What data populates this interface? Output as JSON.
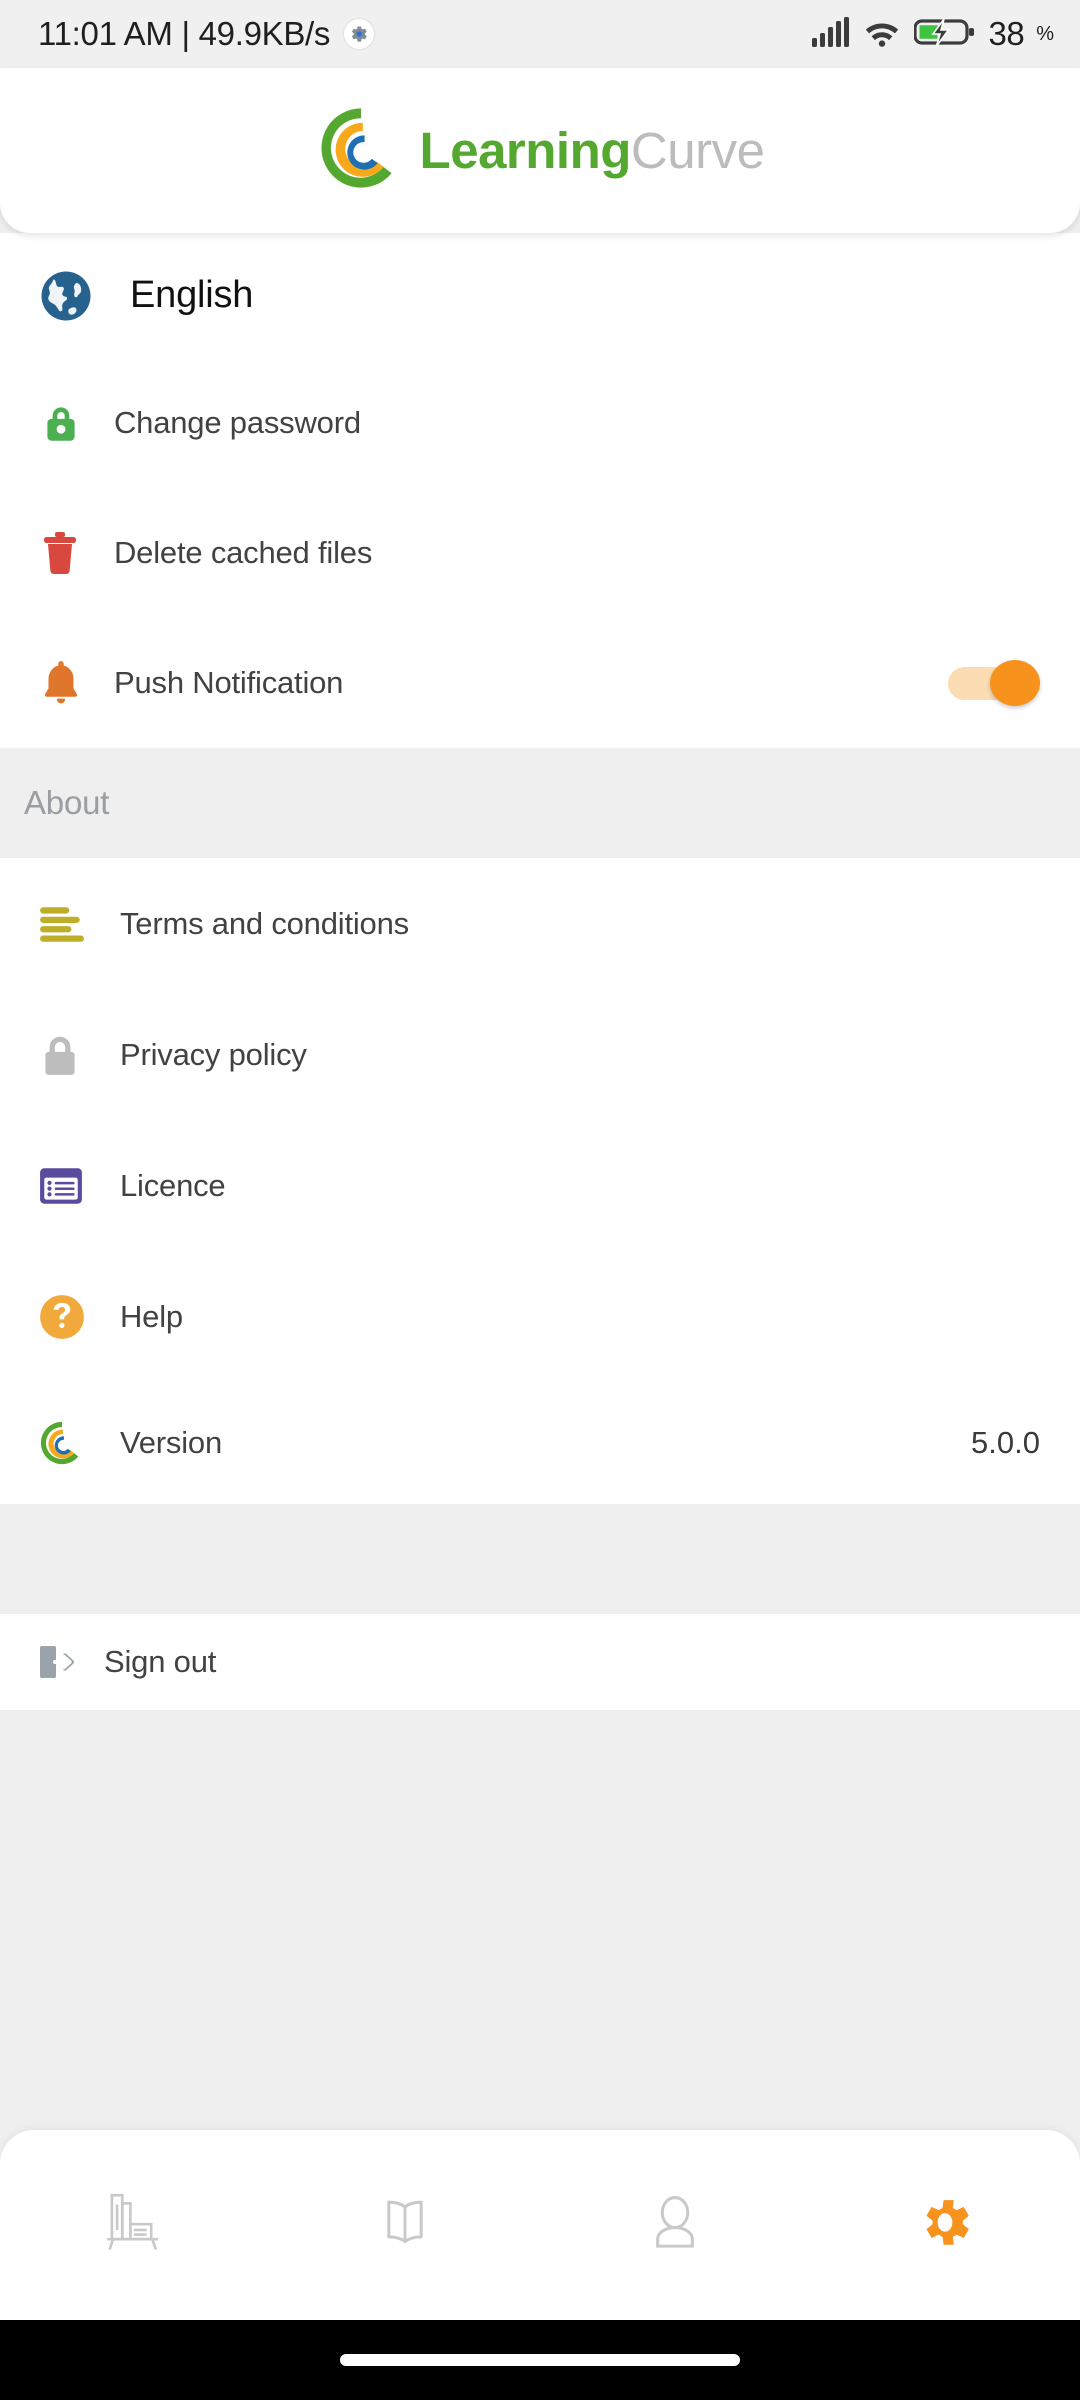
{
  "status_bar": {
    "clock": "11:01 AM | 49.9KB/s",
    "notification_icon": "gear-badge-icon",
    "signal_icon": "cellular-signal-icon",
    "wifi_icon": "wifi-icon",
    "battery_icon": "battery-charging-icon",
    "battery_level": "38",
    "battery_unit": "%"
  },
  "header": {
    "brand_primary": "Learning",
    "brand_secondary": "Curve",
    "logo_icon": "learningcurve-logo-icon",
    "colors": {
      "green": "#54a830",
      "orange": "#f7a81b",
      "blue": "#1f6fb4",
      "gray": "#bcbcbc"
    }
  },
  "settings": {
    "language": {
      "label": "English",
      "icon": "globe-icon"
    },
    "items": [
      {
        "label": "Change password",
        "icon": "lock-green-icon"
      },
      {
        "label": "Delete cached files",
        "icon": "trash-red-icon"
      },
      {
        "label": "Push Notification",
        "icon": "bell-orange-icon",
        "toggle": true,
        "toggle_state": "on"
      }
    ]
  },
  "about": {
    "section_title": "About",
    "items": [
      {
        "label": "Terms and conditions",
        "icon": "list-lines-icon"
      },
      {
        "label": "Privacy policy",
        "icon": "lock-gray-icon"
      },
      {
        "label": "Licence",
        "icon": "license-list-icon"
      },
      {
        "label": "Help",
        "icon": "question-circle-icon"
      }
    ],
    "version": {
      "label": "Version",
      "value": "5.0.0",
      "icon": "app-logo-icon"
    }
  },
  "account": {
    "sign_out": {
      "label": "Sign out",
      "icon": "sign-out-icon"
    }
  },
  "bottom_nav": {
    "active_index": 3,
    "tabs": [
      {
        "name": "library",
        "icon": "bookshelf-icon"
      },
      {
        "name": "reading",
        "icon": "open-book-icon"
      },
      {
        "name": "profile",
        "icon": "person-icon"
      },
      {
        "name": "settings",
        "icon": "gear-icon"
      }
    ],
    "active_color": "#f7931d",
    "inactive_color": "#c9c9c9"
  },
  "system_nav": {
    "gesture_pill": "home-pill"
  }
}
